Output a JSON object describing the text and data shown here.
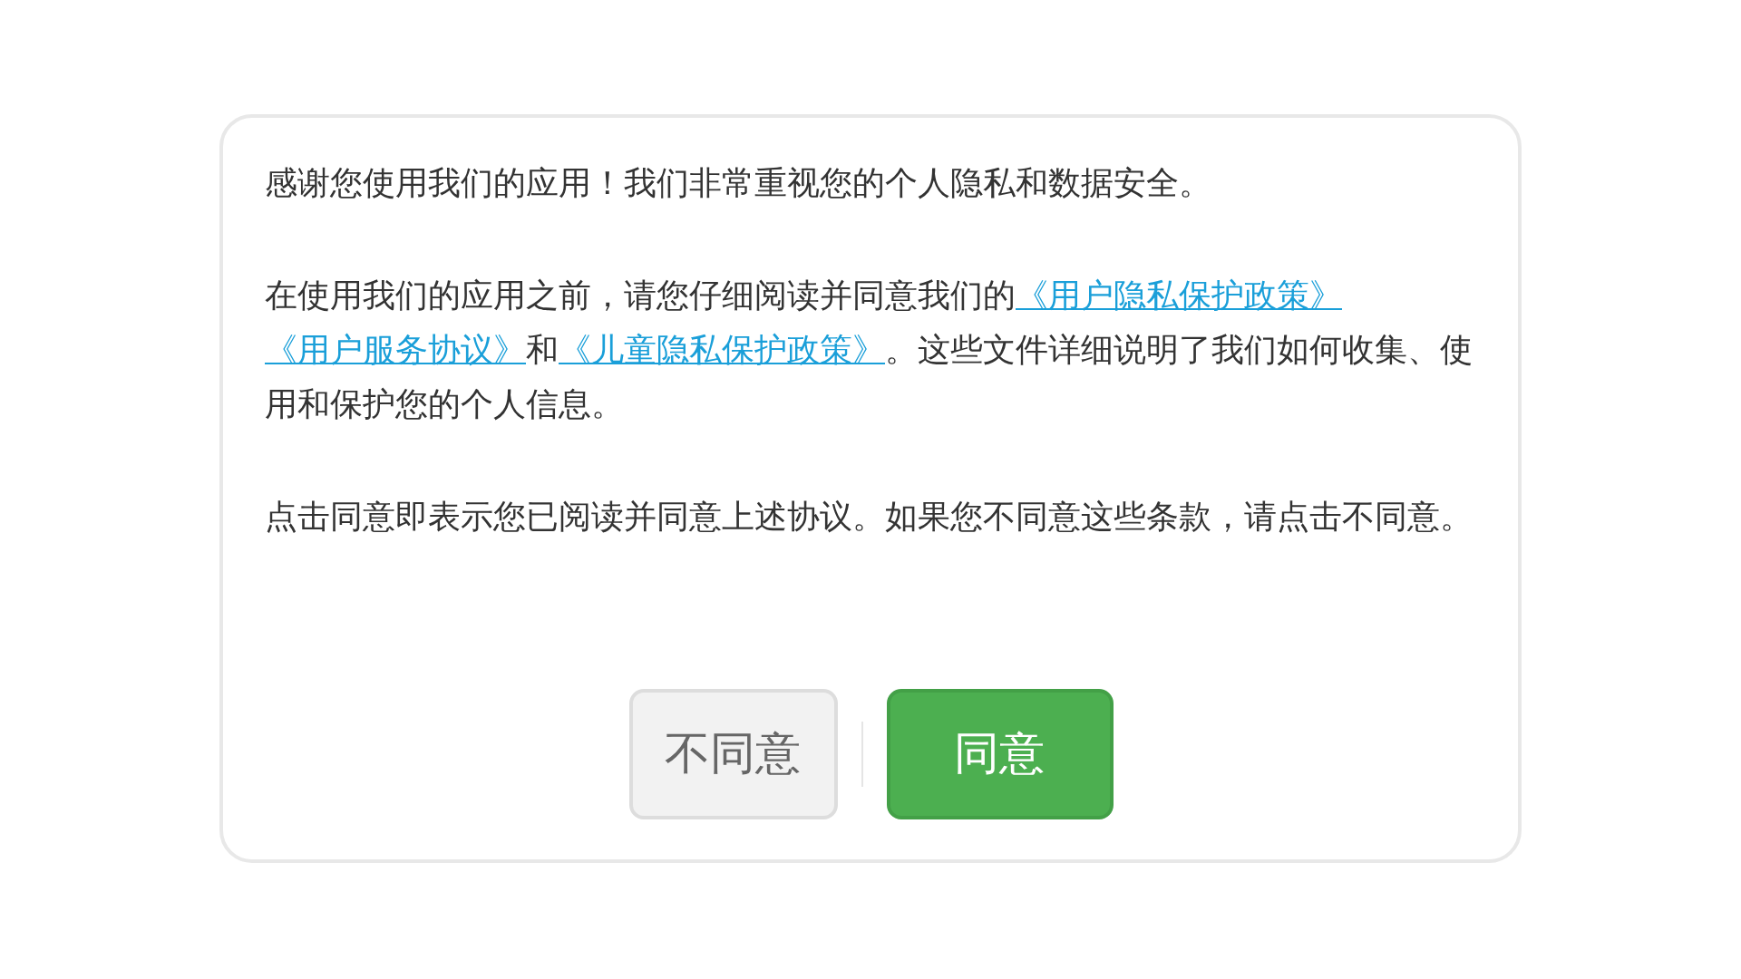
{
  "dialog": {
    "paragraphs": [
      {
        "segments": [
          {
            "kind": "text",
            "text": "感谢您使用我们的应用！我们非常重视您的个人隐私和数据安全。"
          }
        ]
      },
      {
        "segments": [
          {
            "kind": "text",
            "text": "在使用我们的应用之前，请您仔细阅读并同意我们的"
          },
          {
            "kind": "link",
            "text": "《用户隐私保护政策》"
          },
          {
            "kind": "link",
            "text": "《用户服务协议》"
          },
          {
            "kind": "text",
            "text": "和"
          },
          {
            "kind": "link",
            "text": "《儿童隐私保护政策》"
          },
          {
            "kind": "text",
            "text": "。这些文件详细说明了我们如何收集、使用和保护您的个人信息。"
          }
        ]
      },
      {
        "segments": [
          {
            "kind": "text",
            "text": "点击同意即表示您已阅读并同意上述协议。如果您不同意这些条款，请点击不同意。"
          }
        ]
      }
    ],
    "buttons": [
      {
        "label": "不同意",
        "kind": "decline"
      },
      {
        "label": "同意",
        "kind": "accept"
      }
    ]
  }
}
